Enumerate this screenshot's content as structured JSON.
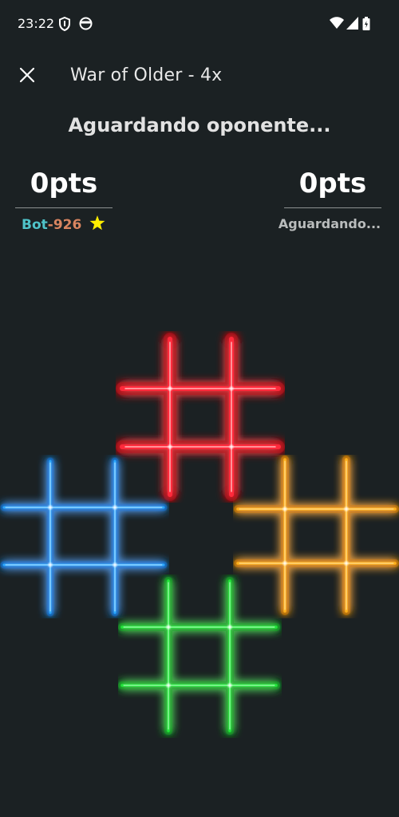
{
  "status_bar": {
    "time": "23:22"
  },
  "app_bar": {
    "title": "War of Older - 4x"
  },
  "game": {
    "status_message": "Aguardando oponente...",
    "players": {
      "left": {
        "score": "0pts",
        "name_prefix": "Bot",
        "name_number": "-926"
      },
      "right": {
        "score": "0pts",
        "name": "Aguardando..."
      }
    },
    "boards": [
      {
        "name": "red",
        "color": "#ff2a3a"
      },
      {
        "name": "blue",
        "color": "#2aa8ff"
      },
      {
        "name": "orange",
        "color": "#ffb21e"
      },
      {
        "name": "green",
        "color": "#22e63a"
      }
    ]
  },
  "icons": {
    "status_left": [
      "shield-icon",
      "face-icon"
    ],
    "status_right": [
      "wifi-icon",
      "signal-icon",
      "battery-icon"
    ],
    "close": "close-icon",
    "star": "star-icon"
  },
  "colors": {
    "background": "#1b2123",
    "bot_label": "#4fc3c9",
    "bot_number": "#d98560",
    "star": "#ffee00"
  }
}
